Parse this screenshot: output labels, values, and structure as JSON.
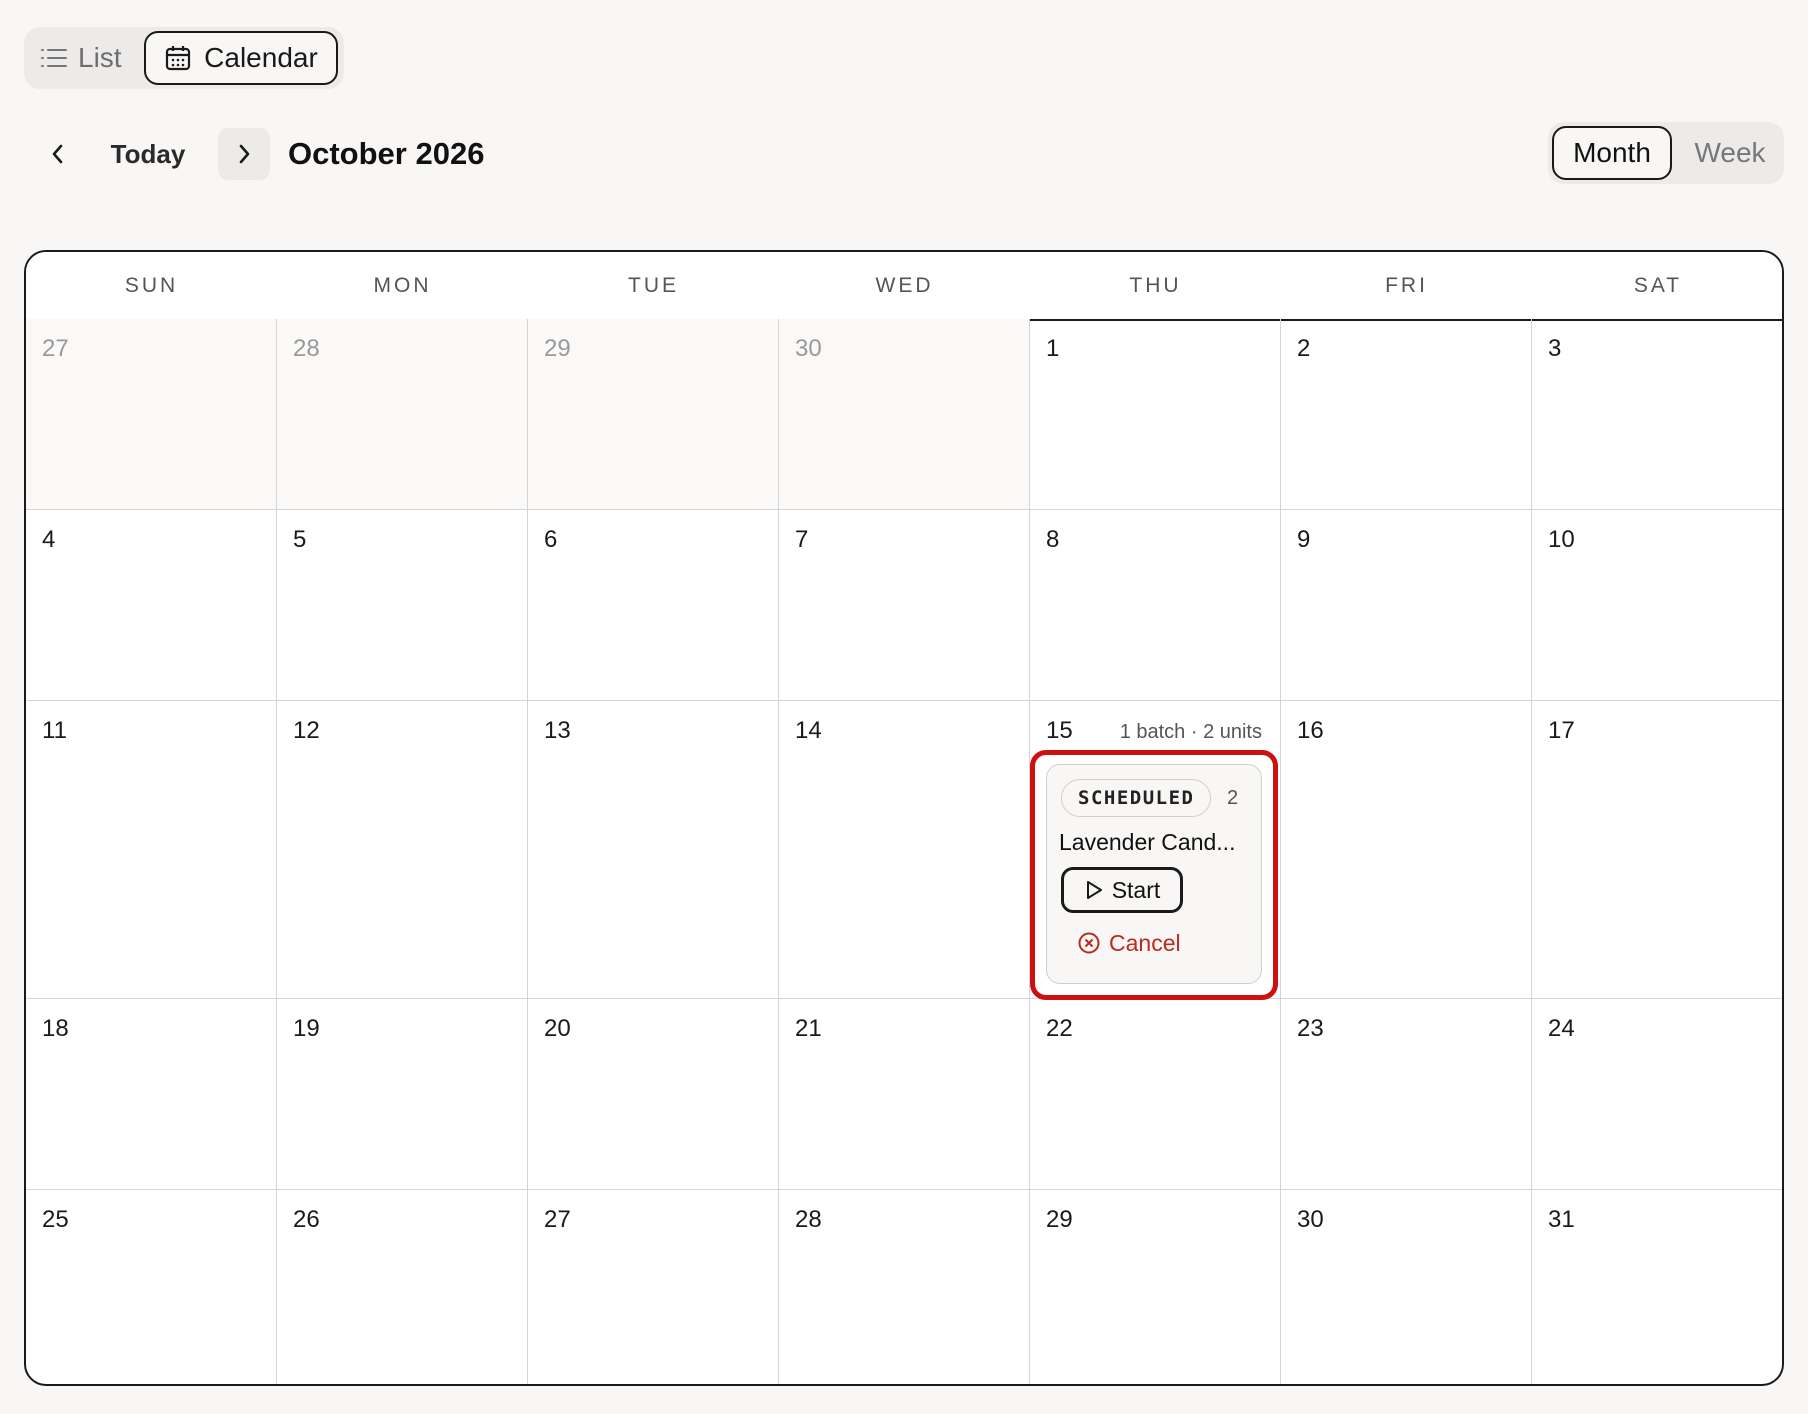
{
  "view_toggle": {
    "list_label": "List",
    "calendar_label": "Calendar",
    "active": "Calendar"
  },
  "nav": {
    "today_label": "Today",
    "month_title": "October 2026"
  },
  "range_toggle": {
    "month_label": "Month",
    "week_label": "Week",
    "active": "Month"
  },
  "weekdays": [
    "SUN",
    "MON",
    "TUE",
    "WED",
    "THU",
    "FRI",
    "SAT"
  ],
  "weeks": [
    [
      {
        "d": "27",
        "other": true
      },
      {
        "d": "28",
        "other": true
      },
      {
        "d": "29",
        "other": true
      },
      {
        "d": "30",
        "other": true
      },
      {
        "d": "1"
      },
      {
        "d": "2"
      },
      {
        "d": "3"
      }
    ],
    [
      {
        "d": "4"
      },
      {
        "d": "5"
      },
      {
        "d": "6"
      },
      {
        "d": "7"
      },
      {
        "d": "8"
      },
      {
        "d": "9"
      },
      {
        "d": "10"
      }
    ],
    [
      {
        "d": "11"
      },
      {
        "d": "12"
      },
      {
        "d": "13"
      },
      {
        "d": "14"
      },
      {
        "d": "15",
        "summary": "1 batch · 2 units"
      },
      {
        "d": "16"
      },
      {
        "d": "17"
      }
    ],
    [
      {
        "d": "18"
      },
      {
        "d": "19"
      },
      {
        "d": "20"
      },
      {
        "d": "21"
      },
      {
        "d": "22"
      },
      {
        "d": "23"
      },
      {
        "d": "24"
      }
    ],
    [
      {
        "d": "25"
      },
      {
        "d": "26"
      },
      {
        "d": "27"
      },
      {
        "d": "28"
      },
      {
        "d": "29"
      },
      {
        "d": "30"
      },
      {
        "d": "31"
      }
    ]
  ],
  "event": {
    "status": "SCHEDULED",
    "count": "2",
    "name": "Lavender Cand...",
    "start_label": "Start",
    "cancel_label": "Cancel"
  },
  "colors": {
    "highlight": "#cc1111",
    "cancel": "#c0281c",
    "border": "#1a1a1a"
  }
}
